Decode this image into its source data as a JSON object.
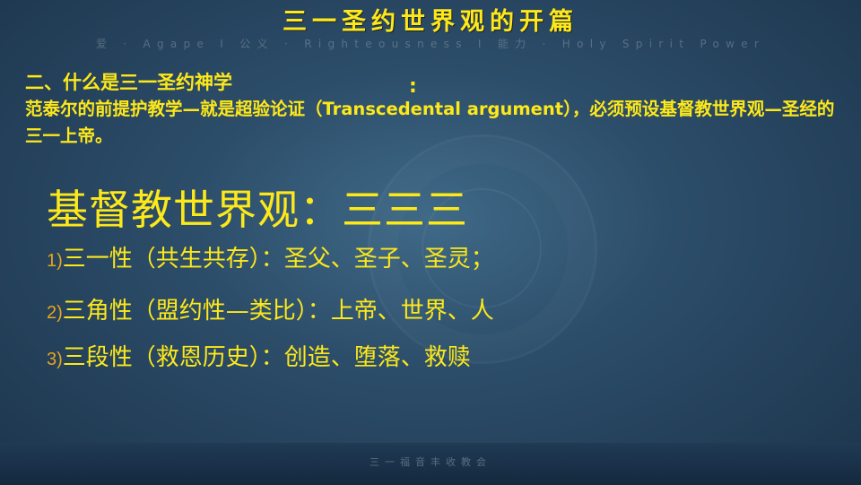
{
  "slide": {
    "title": "三一圣约世界观的开篇",
    "tagline": "爱 · Agape  I  公义 · Righteousness  I  能力 · Holy Spirit Power",
    "heading": "二、什么是三一圣约神学",
    "heading_colon": ":",
    "paragraph": "范泰尔的前提护教学—就是超验论证（Transcedental argument），必须预设基督教世界观—圣经的三一上帝。",
    "big_line": "基督教世界观：三三三",
    "items": [
      {
        "num": "1)",
        "text": "三一性（共生共存）：圣父、圣子、圣灵；"
      },
      {
        "num": "2)",
        "text": "三角性（盟约性—类比）：上帝、世界、人"
      },
      {
        "num": "3)",
        "text": "三段性（救恩历史）：创造、堕落、救赎"
      }
    ],
    "footer": "三一福音丰收教会"
  },
  "colors": {
    "text_yellow": "#fde81a",
    "number_orange": "#e9a41c",
    "background": "#2c4d69"
  }
}
